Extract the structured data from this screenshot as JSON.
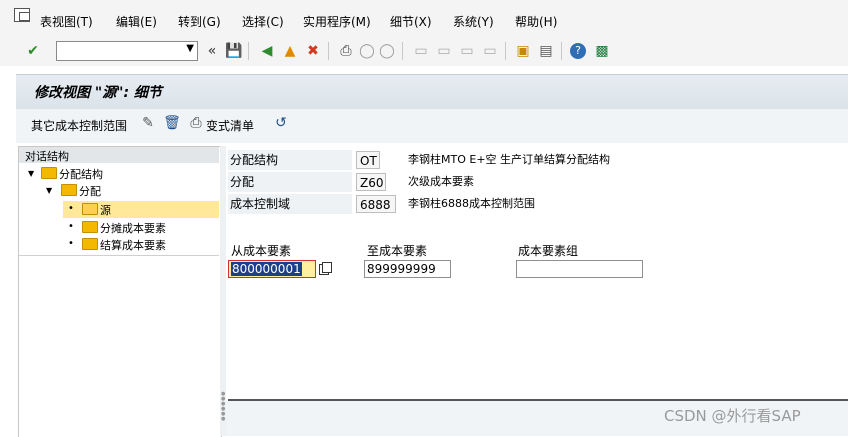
{
  "menubar": {
    "items": [
      "表视图(T)",
      "编辑(E)",
      "转到(G)",
      "选择(C)",
      "实用程序(M)",
      "细节(X)",
      "系统(Y)",
      "帮助(H)"
    ]
  },
  "toolbar": {
    "command_value": "",
    "icons": [
      "enter-icon",
      "back-icon",
      "save-icon",
      "back-arrow-icon",
      "exit-icon",
      "cancel-icon",
      "print-icon",
      "find-icon",
      "find-next-icon",
      "first-page-icon",
      "prev-page-icon",
      "next-page-icon",
      "last-page-icon",
      "new-session-icon",
      "shortcut-icon",
      "help-icon",
      "layout-icon"
    ]
  },
  "title": "修改视图 \"源\": 细节",
  "app_toolbar": {
    "other_range_label": "其它成本控制范围",
    "change_list_label": "变式清单"
  },
  "tree": {
    "header": "对话结构",
    "nodes": [
      {
        "label": "分配结构",
        "level": 0
      },
      {
        "label": "分配",
        "level": 1
      },
      {
        "label": "源",
        "level": 2
      },
      {
        "label": "分摊成本要素",
        "level": 2
      },
      {
        "label": "结算成本要素",
        "level": 2
      }
    ]
  },
  "header_fields": [
    {
      "label": "分配结构",
      "value": "OT",
      "desc": "李钢柱MTO E+空 生产订单结算分配结构"
    },
    {
      "label": "分配",
      "value": "Z60",
      "desc": "次级成本要素"
    },
    {
      "label": "成本控制域",
      "value": "6888",
      "desc": "李钢柱6888成本控制范围"
    }
  ],
  "range": {
    "from_label": "从成本要素",
    "to_label": "至成本要素",
    "group_label": "成本要素组",
    "from_value": "800000001",
    "to_value": "899999999",
    "group_value": ""
  },
  "watermark": "CSDN @外行看SAP",
  "colors": {
    "selection": "#ffe89a",
    "field_highlight": "#ffef9e",
    "folder": "#f5b800",
    "title_bg": "#dbe3ea"
  }
}
